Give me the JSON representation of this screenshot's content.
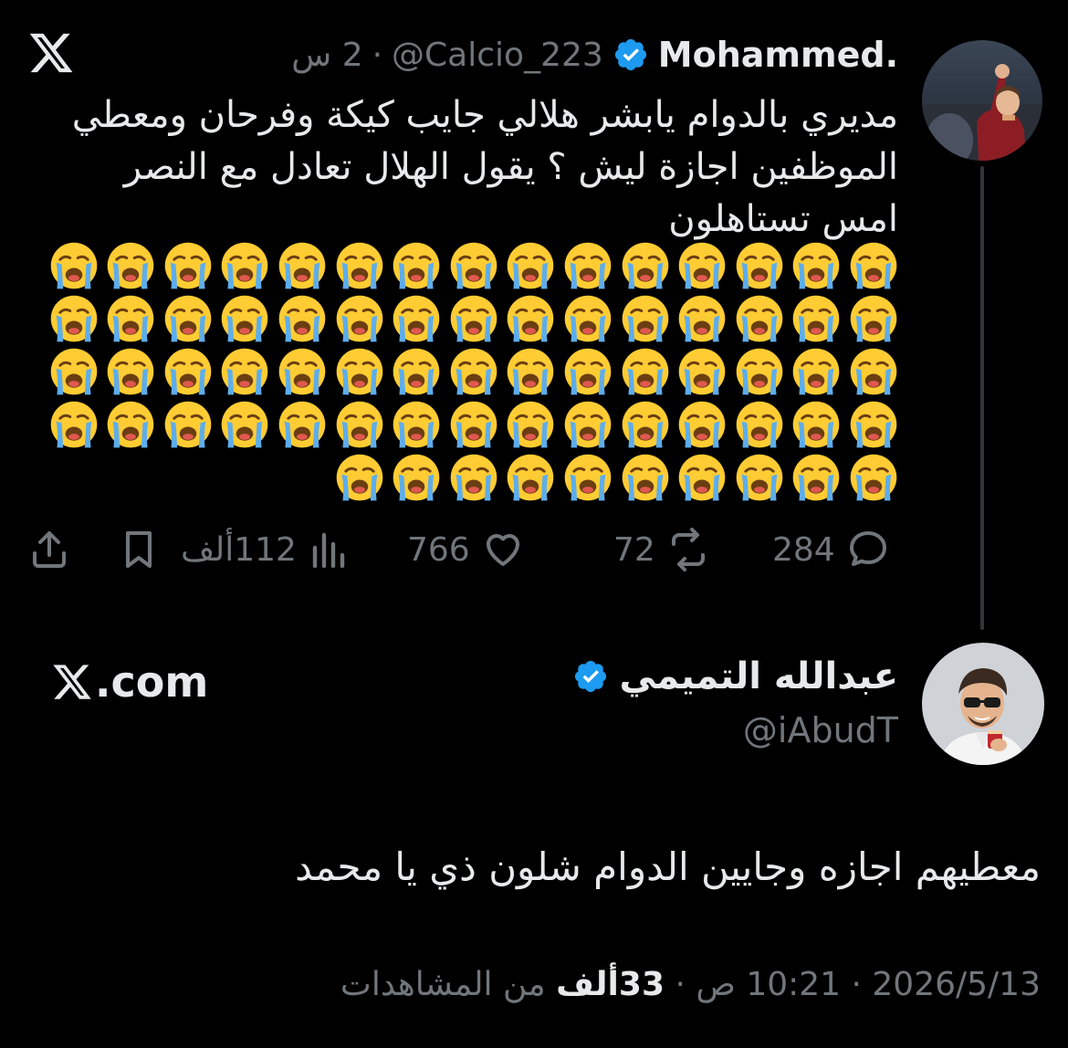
{
  "tweet": {
    "author_name": "Mohammed.",
    "handle": "@Calcio_223",
    "separator": "·",
    "time": "2 س",
    "text_lines": [
      "مديري بالدوام يابشر هلالي جايب كيكة وفرحان ومعطي",
      "الموظفين اجازة ليش ؟ يقول الهلال تعادل مع النصر",
      "امس تستاهلون"
    ],
    "emoji_rows": [
      15,
      15,
      15,
      15,
      10
    ],
    "emoji_name": "loudly-crying-face",
    "actions": {
      "replies": "284",
      "reposts": "72",
      "likes": "766",
      "views": "112ألف"
    }
  },
  "repost": {
    "author_name": "عبدالله التميمي",
    "handle": "@iAbudT",
    "text": "معطيهم اجازه وجايين الدوام شلون ذي يا محمد",
    "date": "2026/5/13",
    "time": "10:21 ص",
    "views_count": "33ألف",
    "views_label": "من المشاهدات"
  },
  "brand": {
    "xcom": ".com"
  },
  "colors": {
    "background": "#000000",
    "text": "#e7e9ea",
    "muted": "#71767b",
    "verified": "#1d9bf0",
    "emoji_yellow": "#ffcc33",
    "tears": "#5dadec"
  }
}
